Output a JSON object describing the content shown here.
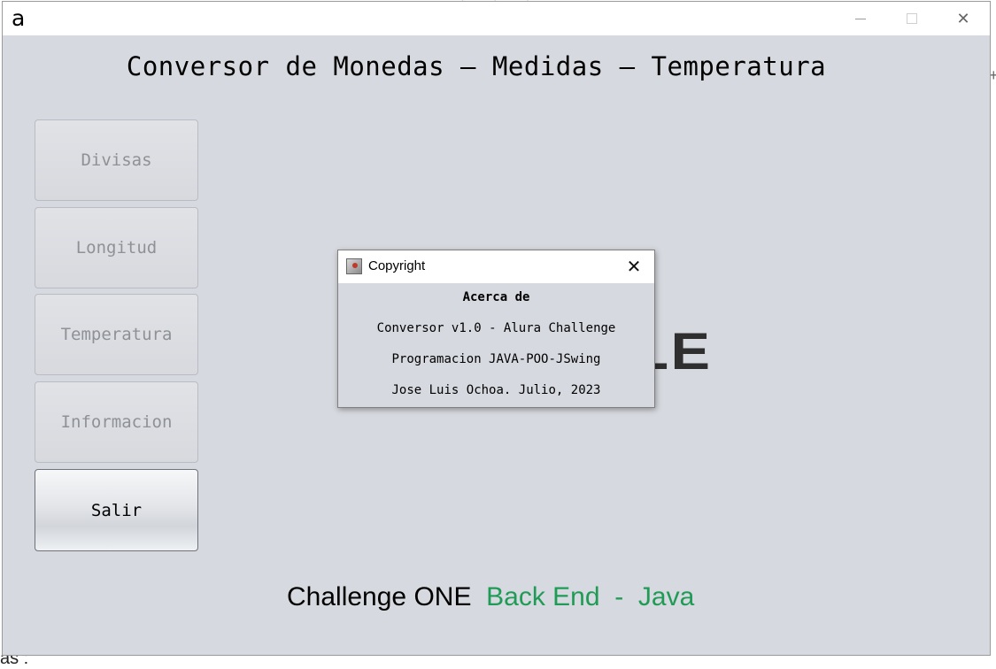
{
  "background": {
    "top_fragment": "• • •",
    "bottom_fragment": "as  :",
    "side_fragment": "+"
  },
  "window": {
    "app_icon": "a",
    "title": "Conversor de Monedas – Medidas – Temperatura",
    "controls": {
      "minimize": "minimize",
      "maximize": "maximize",
      "close": "✕"
    }
  },
  "nav": {
    "items": [
      {
        "label": "Divisas",
        "enabled": false
      },
      {
        "label": "Longitud",
        "enabled": false
      },
      {
        "label": "Temperatura",
        "enabled": false
      },
      {
        "label": "Informacion",
        "enabled": false
      },
      {
        "label": "Salir",
        "enabled": true
      }
    ]
  },
  "logo": {
    "text": "RACLE"
  },
  "footer": {
    "part1": "Challenge ONE ",
    "part2": " Back End ",
    "part3": " - ",
    "part4": " Java",
    "accent_color": "#1f9b55"
  },
  "dialog": {
    "title": "Copyright",
    "close": "✕",
    "heading": "Acerca de",
    "lines": [
      "Conversor v1.0 - Alura Challenge",
      "Programacion JAVA-POO-JSwing",
      "Jose Luis Ochoa. Julio, 2023"
    ]
  }
}
